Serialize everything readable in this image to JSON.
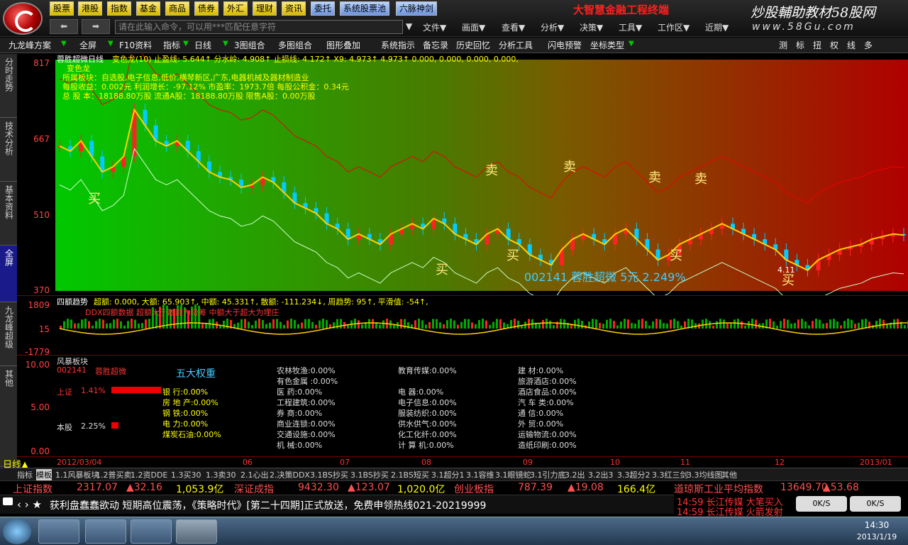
{
  "menu": [
    "股票",
    "港股",
    "指数",
    "基金",
    "商品",
    "债券",
    "外汇",
    "理财",
    "资讯",
    "委托",
    "系统股票池",
    "六脉神剑"
  ],
  "brand": {
    "title": "大智慧金融工程终端",
    "site_cn": "炒股輔助教材58股网",
    "site_url": "www.58Gu.com"
  },
  "command_placeholder": "请在此输入命令，可以用***匹配任意字符",
  "menu2": [
    "文件▼",
    "画面▼",
    "查看▼",
    "分析▼",
    "决策▼",
    "工具▼",
    "工作区▼",
    "近期▼"
  ],
  "toolbar": [
    "九龙峰方案",
    "全屏",
    "F10资料",
    "指标",
    "日线",
    "3图组合",
    "多图组合",
    "图形叠加",
    "系统指示",
    "备忘录",
    "历史回忆",
    "分析工具",
    "闪电预警",
    "坐标类型"
  ],
  "toolbar_right": [
    "测",
    "标",
    "扭",
    "权",
    "线",
    "多"
  ],
  "sidebar": [
    "分时走势",
    "技术分析",
    "基本资料",
    "全屏",
    "九龙峰超级",
    "其他"
  ],
  "main": {
    "stock_name": "蓉胜超微日线",
    "indicator_line": "变色龙(10) 止盈线: 5.644↑ 分水岭: 4.908↑ 止损线: 4.172↑ X9: 4.973↑ 4.973↑ 0.000, 0.000, 0.000, 0.000,",
    "info": [
      "变色龙",
      "所属板块：自选股,电子信息,低价,横琴新区,广东,电器机械及器材制造业",
      "每股收益：0.002元   利润增长：-97.12%   市盈率：1973.7倍   每股公积金：0.34元",
      "总 股 本：18188.80万股 流通A股：18188.80万股  限售A股：0.00万股"
    ],
    "y_labels": [
      "817",
      "667",
      "510",
      "370"
    ],
    "buy": "买",
    "sell": "卖",
    "quote": "002141  蓉胜超微  5元  2.249%",
    "low_label": "4.11"
  },
  "chart_data": {
    "type": "line",
    "title": "蓉胜超微日线",
    "ylim": [
      370,
      817
    ],
    "x_ticks": [
      "2012/03/04",
      "06",
      "07",
      "08",
      "09",
      "10",
      "11",
      "12",
      "2013/01"
    ],
    "close": [
      650,
      640,
      660,
      630,
      600,
      610,
      630,
      720,
      690,
      660,
      650,
      660,
      640,
      620,
      600,
      590,
      585,
      570,
      575,
      590,
      580,
      560,
      540,
      530,
      520,
      500,
      490,
      470,
      480,
      470,
      460,
      480,
      490,
      500,
      490,
      510,
      500,
      480,
      470,
      460,
      480,
      490,
      470,
      460,
      440,
      430,
      420,
      450,
      470,
      480,
      470,
      460,
      480,
      490,
      470,
      450,
      430,
      440,
      460,
      470,
      480,
      490,
      500,
      490,
      480,
      470,
      460,
      450,
      430,
      420,
      410,
      430,
      440,
      450,
      455,
      460,
      470,
      475,
      480,
      478
    ]
  },
  "indicator2": {
    "title": "四额趋势",
    "line": "超额: 0.000, 大额: 65.903↑, 中额: 45.331↑, 散额: -111.234↓, 周趋势: 95↑, 平滑值: -54↑,",
    "sub": "DDX四额数据    超额大于散额为吸筹    中额大于超大为埋庄",
    "y_labels": [
      "1809",
      "15",
      "-1779"
    ]
  },
  "sector": {
    "title": "风暴板块",
    "code": "002141",
    "name": "蓉胜超微",
    "heading": "五大权重",
    "y_labels": [
      "10.00",
      "5.00",
      "0.00"
    ],
    "sh": "上证",
    "sh_val": "1.41%",
    "self": "本股",
    "self_val": "2.25%",
    "col1": [
      "银    行:0.00%",
      "房 地 产:0.00%",
      "钢    铁:0.00%",
      "电    力:0.00%",
      "煤炭石油:0.00%"
    ],
    "col2": [
      "农林牧渔:0.00%",
      "有色金属 :0.00%",
      "医    药:0.00%",
      "工程建筑:0.00%",
      "券    商:0.00%",
      "商业连锁:0.00%",
      "交通设施:0.00%",
      "机    械:0.00%"
    ],
    "col3": [
      "教育传媒:0.00%",
      "",
      "电    器:0.00%",
      "电子信息:0.00%",
      "服装纺织:0.00%",
      "供水供气:0.00%",
      "化工化纤:0.00%",
      "计 算 机:0.00%"
    ],
    "col4": [
      "建    材:0.00%",
      "旅游酒店:0.00%",
      "酒店食品:0.00%",
      "汽 车 类:0.00%",
      "通    信:0.00%",
      "外    贸:0.00%",
      "运输物流:0.00%",
      "造纸印刷:0.00%"
    ]
  },
  "period": "日线▲",
  "tabs": [
    "指标",
    "模板",
    "1.1风暴板块",
    "1.2普买卖",
    "1.2资DDE",
    "1.3买30",
    "1.3卖30",
    "2.1心出",
    "2.决策DDX",
    "3.1BS抄买",
    "3.1BS抄买",
    "2.1BS短买",
    "3.1超分1",
    "3.1容维",
    "3.1眼镜蛇",
    "3.1引力底",
    "3.2出",
    "3.2出3",
    "3.3超分2",
    "3.3红三剑",
    "3.3均线图",
    "其他"
  ],
  "ticker": [
    {
      "name": "上证指数",
      "px": "2317.07",
      "chg": "▲32.16",
      "vol": "1,053.9亿"
    },
    {
      "name": "深证成指",
      "px": "9432.30",
      "chg": "▲123.07",
      "vol": "1,020.0亿"
    },
    {
      "name": "创业板指",
      "px": "787.39",
      "chg": "▲19.08",
      "vol": "166.4亿"
    },
    {
      "name": "道琼斯工业平均指数",
      "px": "13649.70",
      "chg": "▲53.68",
      "vol": ""
    }
  ],
  "news": "获利盘蠢蠢欲动 短期高位震荡，《策略时代》[第二十四期]正式放送，免费申领热线021-20219999",
  "alerts": [
    "14:59 长江传媒 大笔买入",
    "14:59 长江传媒 火箭发射"
  ],
  "net": [
    "0K/S",
    "0K/S"
  ],
  "clock": {
    "time": "14:30",
    "date": "2013/1/19"
  }
}
